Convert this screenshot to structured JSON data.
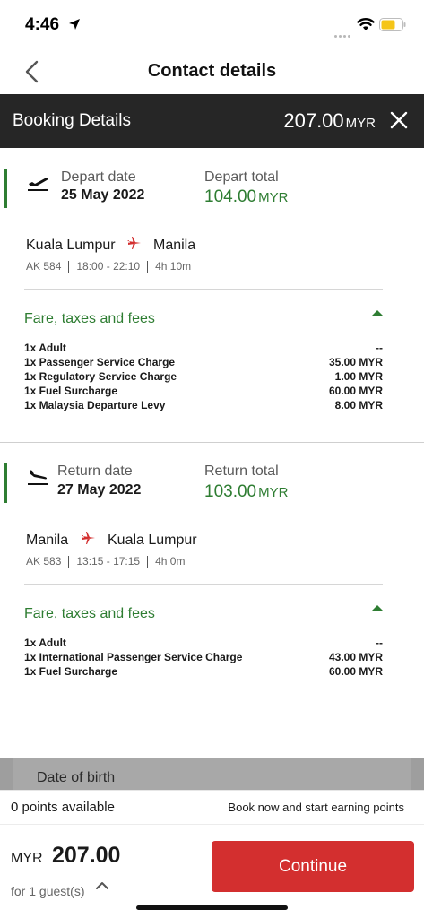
{
  "status": {
    "time": "4:46",
    "icons": [
      "location-arrow-icon",
      "signal-dots-icon",
      "wifi-icon",
      "battery-icon"
    ],
    "battery_color": "#f5c518"
  },
  "header": {
    "title": "Contact details",
    "back_icon": "chevron-left-icon"
  },
  "booking": {
    "title": "Booking Details",
    "total_amount": "207.00",
    "total_currency": "MYR",
    "close_icon": "close-icon"
  },
  "depart": {
    "date_label": "Depart date",
    "date": "25 May 2022",
    "total_label": "Depart total",
    "total_amount": "104.00",
    "total_currency": "MYR",
    "origin": "Kuala Lumpur",
    "destination": "Manila",
    "flight_no": "AK 584",
    "time_range": "18:00 - 22:10",
    "duration": "4h 10m",
    "fare_title": "Fare, taxes and fees",
    "fees": [
      {
        "name": "1x Adult",
        "amount": "--"
      },
      {
        "name": "1x Passenger Service Charge",
        "amount": "35.00 MYR"
      },
      {
        "name": "1x Regulatory Service Charge",
        "amount": "1.00 MYR"
      },
      {
        "name": "1x Fuel Surcharge",
        "amount": "60.00 MYR"
      },
      {
        "name": "1x Malaysia Departure Levy",
        "amount": "8.00 MYR"
      }
    ]
  },
  "return": {
    "date_label": "Return date",
    "date": "27 May 2022",
    "total_label": "Return total",
    "total_amount": "103.00",
    "total_currency": "MYR",
    "origin": "Manila",
    "destination": "Kuala Lumpur",
    "flight_no": "AK 583",
    "time_range": "13:15 - 17:15",
    "duration": "4h 0m",
    "fare_title": "Fare, taxes and fees",
    "fees": [
      {
        "name": "1x Adult",
        "amount": "--"
      },
      {
        "name": "1x International Passenger Service Charge",
        "amount": "43.00 MYR"
      },
      {
        "name": "1x Fuel Surcharge",
        "amount": "60.00 MYR"
      }
    ]
  },
  "form": {
    "dob_label": "Date of birth"
  },
  "points": {
    "available": "0 points available",
    "promo": "Book now and start earning points"
  },
  "footer": {
    "currency": "MYR",
    "amount": "207.00",
    "guests": "for 1 guest(s)",
    "continue_label": "Continue"
  },
  "colors": {
    "accent_green": "#2e7d32",
    "brand_red": "#d32f2f",
    "header_dark": "#262626"
  }
}
